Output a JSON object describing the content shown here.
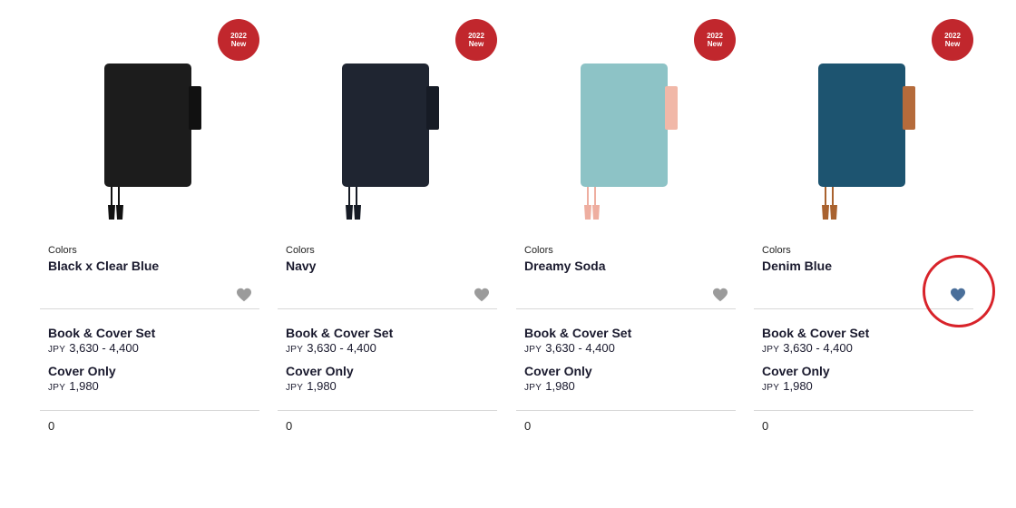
{
  "products": [
    {
      "badge_year": "2022",
      "badge_text": "New",
      "colors_caption": "Colors",
      "color_name": "Black x Clear Blue",
      "favorited": false,
      "book_cover_label": "Book & Cover Set",
      "book_cover_currency": "JPY",
      "book_cover_price": "3,630 - 4,400",
      "cover_only_label": "Cover Only",
      "cover_only_currency": "JPY",
      "cover_only_price": "1,980",
      "count": "0",
      "colors": {
        "body": "#1c1c1c",
        "tab": "#111111",
        "cord": "#111111"
      }
    },
    {
      "badge_year": "2022",
      "badge_text": "New",
      "colors_caption": "Colors",
      "color_name": "Navy",
      "favorited": false,
      "book_cover_label": "Book & Cover Set",
      "book_cover_currency": "JPY",
      "book_cover_price": "3,630 - 4,400",
      "cover_only_label": "Cover Only",
      "cover_only_currency": "JPY",
      "cover_only_price": "1,980",
      "count": "0",
      "colors": {
        "body": "#1f2531",
        "tab": "#161b25",
        "cord": "#161b25"
      }
    },
    {
      "badge_year": "2022",
      "badge_text": "New",
      "colors_caption": "Colors",
      "color_name": "Dreamy Soda",
      "favorited": false,
      "book_cover_label": "Book & Cover Set",
      "book_cover_currency": "JPY",
      "book_cover_price": "3,630 - 4,400",
      "cover_only_label": "Cover Only",
      "cover_only_currency": "JPY",
      "cover_only_price": "1,980",
      "count": "0",
      "colors": {
        "body": "#8dc3c6",
        "tab": "#f1b8a8",
        "cord": "#eeaea0"
      }
    },
    {
      "badge_year": "2022",
      "badge_text": "New",
      "colors_caption": "Colors",
      "color_name": "Denim Blue",
      "favorited": true,
      "book_cover_label": "Book & Cover Set",
      "book_cover_currency": "JPY",
      "book_cover_price": "3,630 - 4,400",
      "cover_only_label": "Cover Only",
      "cover_only_currency": "JPY",
      "cover_only_price": "1,980",
      "count": "0",
      "colors": {
        "body": "#1d5470",
        "tab": "#b56b3b",
        "cord": "#a9622f"
      }
    }
  ],
  "icons": {
    "favorite": "heart-icon"
  },
  "theme": {
    "badge": "#c1272d",
    "heart_inactive": "#9b9b9b",
    "heart_active": "#4a6f9a",
    "highlight": "#d8232a"
  }
}
